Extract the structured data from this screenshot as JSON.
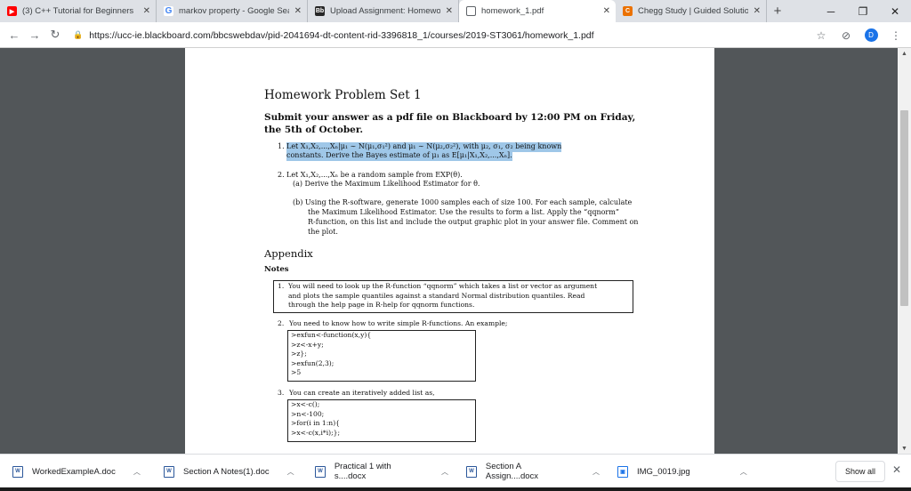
{
  "tabs": [
    {
      "title": "(3) C++ Tutorial for Beginners",
      "icon": "youtube-icon",
      "color": "#ff0000",
      "glyph": "▶",
      "active": false
    },
    {
      "title": "markov property - Google Sea",
      "icon": "google-icon",
      "color": "#4285f4",
      "glyph": "G",
      "active": false
    },
    {
      "title": "Upload Assignment: Homewor",
      "icon": "blackboard-icon",
      "color": "#262626",
      "glyph": "Bb",
      "active": false
    },
    {
      "title": "homework_1.pdf",
      "icon": "document-icon",
      "color": "#ffffff",
      "glyph": "",
      "active": true
    },
    {
      "title": "Chegg Study | Guided Solution",
      "icon": "chegg-icon",
      "color": "#eb7100",
      "glyph": "C",
      "active": false
    }
  ],
  "toolbar": {
    "url": "https://ucc-ie.blackboard.com/bbcswebdav/pid-2041694-dt-content-rid-3396818_1/courses/2019-ST3061/homework_1.pdf",
    "avatar_letter": "D"
  },
  "pdf": {
    "title": "Homework Problem Set 1",
    "submit": "Submit your answer as a pdf file on Blackboard by 12:00 PM on Friday, the 5th of October.",
    "q1_num": "1.",
    "q1_line1": "Let X₁,X₂,...,Xₙ|μ₁ ∼ N(μ₁,σ₁²) and μ₁ ∼ N(μ₂,σ₂²), with μ₂, σ₁, σ₂ being known",
    "q1_line2": "constants. Derive the Bayes estimate of μ₁ as E[μ₁|X₁,X₂,...,Xₙ].",
    "q2_num": "2.",
    "q2_line1": "Let X₁,X₂,...,Xₙ be a random sample from EXP(θ).",
    "q2a": "(a) Derive the Maximum Likelihood Estimator for θ.",
    "q2b_1": "(b) Using the R-software, generate 1000 samples each of size 100. For each sample, calculate",
    "q2b_2": "the Maximum Likelihood Estimator. Use the results to form a list. Apply the “qqnorm”",
    "q2b_3": "R-function, on this list and include the output graphic plot in your answer file. Comment on",
    "q2b_4": "the plot.",
    "appendix": "Appendix",
    "notes": "Notes",
    "n1_num": "1.",
    "n1_1": "You will need to look up the R-function “qqnorm” which takes a list or vector as argument",
    "n1_2": "and plots the sample quantiles against a standard Normal distribution quantiles. Read",
    "n1_3": "through the help page in R-help for qqnorm functions.",
    "n2_num": "2.",
    "n2": "You need to know how to write simple R-functions. An example;",
    "code1": [
      ">exfun<-function(x,y){",
      ">z<-x+y;",
      ">z};",
      ">exfun(2,3);",
      ">5"
    ],
    "n3_num": "3.",
    "n3": "You can create an iteratively added list as,",
    "code2": [
      ">x<-c();",
      ">n<-100;",
      ">for(i in 1:n){",
      ">x<-c(x,i*i);};"
    ]
  },
  "downloads": [
    {
      "name": "WorkedExampleA.doc",
      "icon": "word-doc-icon"
    },
    {
      "name": "Section A Notes(1).doc",
      "icon": "word-doc-icon"
    },
    {
      "name": "Practical 1 with s....docx",
      "icon": "word-doc-icon"
    },
    {
      "name": "Section A Assign....docx",
      "icon": "word-doc-icon"
    },
    {
      "name": "IMG_0019.jpg",
      "icon": "image-file-icon"
    }
  ],
  "shelf": {
    "show_all": "Show all"
  }
}
